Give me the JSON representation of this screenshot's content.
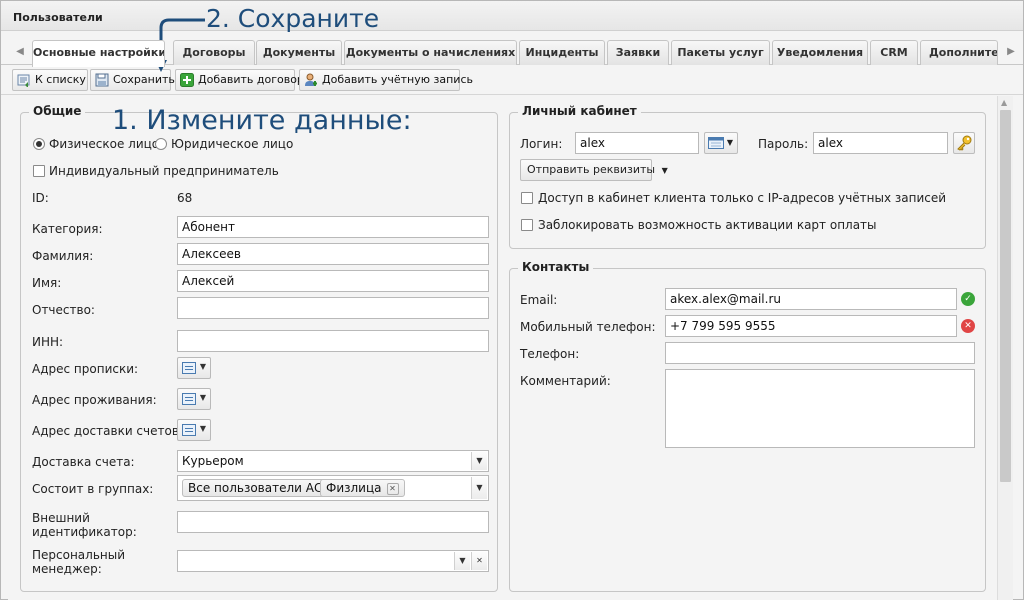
{
  "window": {
    "title": "Пользователи"
  },
  "tabs": [
    {
      "label": "Основные настройки",
      "active": true
    },
    {
      "label": "Договоры"
    },
    {
      "label": "Документы"
    },
    {
      "label": "Документы о начислениях"
    },
    {
      "label": "Инциденты"
    },
    {
      "label": "Заявки"
    },
    {
      "label": "Пакеты услуг"
    },
    {
      "label": "Уведомления"
    },
    {
      "label": "CRM"
    },
    {
      "label": "Дополнительно"
    }
  ],
  "toolbar": {
    "back_label": "К списку",
    "save_label": "Сохранить",
    "add_contract_label": "Добавить договор",
    "add_account_label": "Добавить учётную запись"
  },
  "general": {
    "legend": "Общие",
    "person_type": {
      "individual": "Физическое лицо",
      "legal": "Юридическое лицо",
      "selected": "individual"
    },
    "entrepreneur_label": "Индивидуальный предприниматель",
    "id_label": "ID:",
    "id_value": "68",
    "category_label": "Категория:",
    "category_value": "Абонент",
    "surname_label": "Фамилия:",
    "surname_value": "Алексеев",
    "name_label": "Имя:",
    "name_value": "Алексей",
    "patronymic_label": "Отчество:",
    "patronymic_value": "",
    "inn_label": "ИНН:",
    "inn_value": "",
    "reg_address_label": "Адрес прописки:",
    "live_address_label": "Адрес проживания:",
    "bill_address_label": "Адрес доставки счетов:",
    "delivery_label": "Доставка счета:",
    "delivery_value": "Курьером",
    "groups_label": "Состоит в группах:",
    "groups": [
      "Все пользователи АСР",
      "Физлица"
    ],
    "ext_id_label_1": "Внешний",
    "ext_id_label_2": "идентификатор:",
    "ext_id_value": "",
    "manager_label_1": "Персональный",
    "manager_label_2": "менеджер:",
    "manager_value": ""
  },
  "cabinet": {
    "legend": "Личный кабинет",
    "login_label": "Логин:",
    "login_value": "alex",
    "password_label": "Пароль:",
    "password_value": "alex",
    "send_label": "Отправить реквизиты",
    "ip_only_label": "Доступ в кабинет клиента только с IP-адресов учётных записей",
    "block_cards_label": "Заблокировать возможность активации карт оплаты"
  },
  "contacts": {
    "legend": "Контакты",
    "email_label": "Email:",
    "email_value": "akex.alex@mail.ru",
    "mobile_label": "Мобильный телефон:",
    "mobile_value": "+7 799 595 9555",
    "phone_label": "Телефон:",
    "phone_value": "",
    "comment_label": "Комментарий:",
    "comment_value": ""
  },
  "annotations": {
    "step1": "1. Измените данные:",
    "step2": "2. Сохраните"
  },
  "colors": {
    "annotation": "#1e4d7b",
    "valid": "#3aa53a",
    "invalid": "#e04545"
  }
}
